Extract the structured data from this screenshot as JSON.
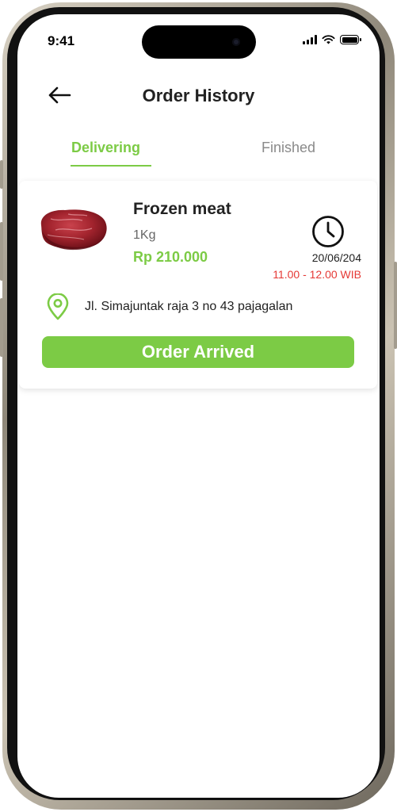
{
  "status_bar": {
    "time": "9:41"
  },
  "header": {
    "title": "Order History",
    "back_icon": "arrow-left-icon"
  },
  "tabs": [
    {
      "label": "Delivering",
      "active": true
    },
    {
      "label": "Finished",
      "active": false
    }
  ],
  "order": {
    "product_name": "Frozen meat",
    "quantity": "1Kg",
    "price": "Rp 210.000",
    "date": "20/06/204",
    "time_range": "11.00 - 12.00 WIB",
    "address": "Jl. Simajuntak raja 3 no 43 pajagalan",
    "action_label": "Order Arrived"
  },
  "colors": {
    "accent": "#7ccb45",
    "time_red": "#e53935",
    "text": "#222222"
  }
}
